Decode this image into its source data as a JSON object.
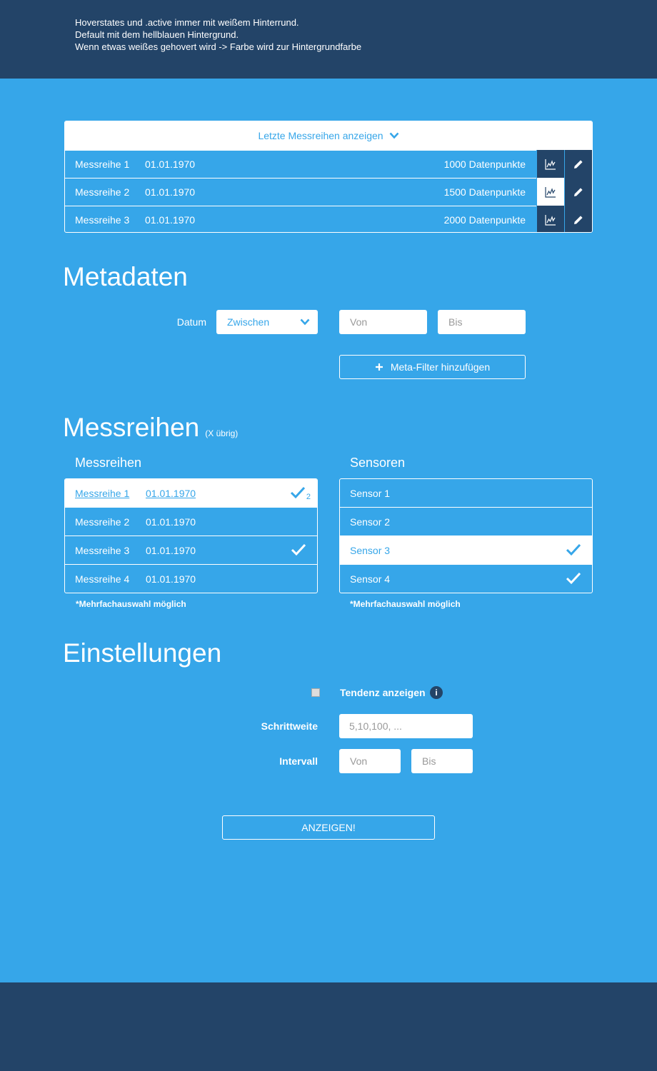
{
  "notes": {
    "line1": "Hoverstates und .active immer mit weißem Hinterrund.",
    "line2": "Default mit dem hellblauen Hintergrund.",
    "line3": "Wenn etwas weißes gehovert wird -> Farbe wird zur Hintergrundfarbe"
  },
  "recent": {
    "toggle_label": "Letzte Messreihen anzeigen",
    "rows": [
      {
        "name": "Messreihe 1",
        "date": "01.01.1970",
        "points": "1000 Datenpunkte"
      },
      {
        "name": "Messreihe 2",
        "date": "01.01.1970",
        "points": "1500 Datenpunkte"
      },
      {
        "name": "Messreihe 3",
        "date": "01.01.1970",
        "points": "2000 Datenpunkte"
      }
    ]
  },
  "metadata": {
    "title": "Metadaten",
    "date_label": "Datum",
    "select_value": "Zwischen",
    "from_placeholder": "Von",
    "to_placeholder": "Bis",
    "add_filter_label": "Meta-Filter hinzufügen"
  },
  "series": {
    "title": "Messreihen",
    "remaining": "(X übrig)",
    "left_title": "Messreihen",
    "right_title": "Sensoren",
    "items": [
      {
        "name": "Messreihe 1",
        "date": "01.01.1970",
        "count": "2"
      },
      {
        "name": "Messreihe 2",
        "date": "01.01.1970"
      },
      {
        "name": "Messreihe 3",
        "date": "01.01.1970"
      },
      {
        "name": "Messreihe 4",
        "date": "01.01.1970"
      }
    ],
    "sensors": [
      {
        "name": "Sensor 1"
      },
      {
        "name": "Sensor 2"
      },
      {
        "name": "Sensor 3"
      },
      {
        "name": "Sensor 4"
      }
    ],
    "footnote_left": "*Mehrfachauswahl möglich",
    "footnote_right": "*Mehrfachauswahl möglich"
  },
  "settings": {
    "title": "Einstellungen",
    "trend_label": "Tendenz anzeigen",
    "info_glyph": "i",
    "step_label": "Schrittweite",
    "step_placeholder": "5,10,100, ...",
    "interval_label": "Intervall",
    "interval_from": "Von",
    "interval_to": "Bis",
    "submit_label": "ANZEIGEN!"
  },
  "colors": {
    "background": "#36a6e9",
    "dark": "#234468",
    "white": "#ffffff"
  }
}
